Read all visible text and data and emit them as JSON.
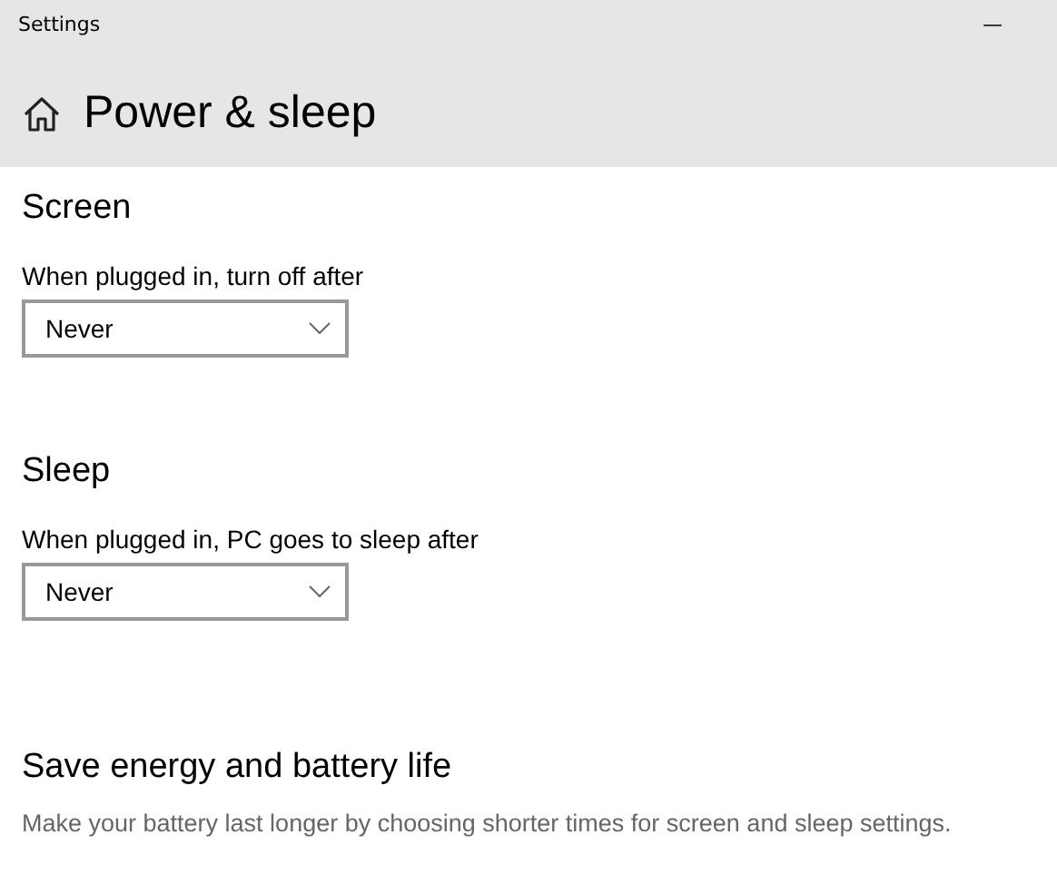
{
  "window": {
    "title": "Settings",
    "minimize_glyph": "—"
  },
  "page_title": "Power & sleep",
  "sections": [
    {
      "kind": "dropdown",
      "heading": "Screen",
      "label": "When plugged in, turn off after",
      "value": "Never"
    },
    {
      "kind": "dropdown",
      "heading": "Sleep",
      "label": "When plugged in, PC goes to sleep after",
      "value": "Never"
    },
    {
      "kind": "description",
      "heading": "Save energy and battery life",
      "text": "Make your battery last longer by choosing shorter times for screen and sleep settings."
    }
  ]
}
